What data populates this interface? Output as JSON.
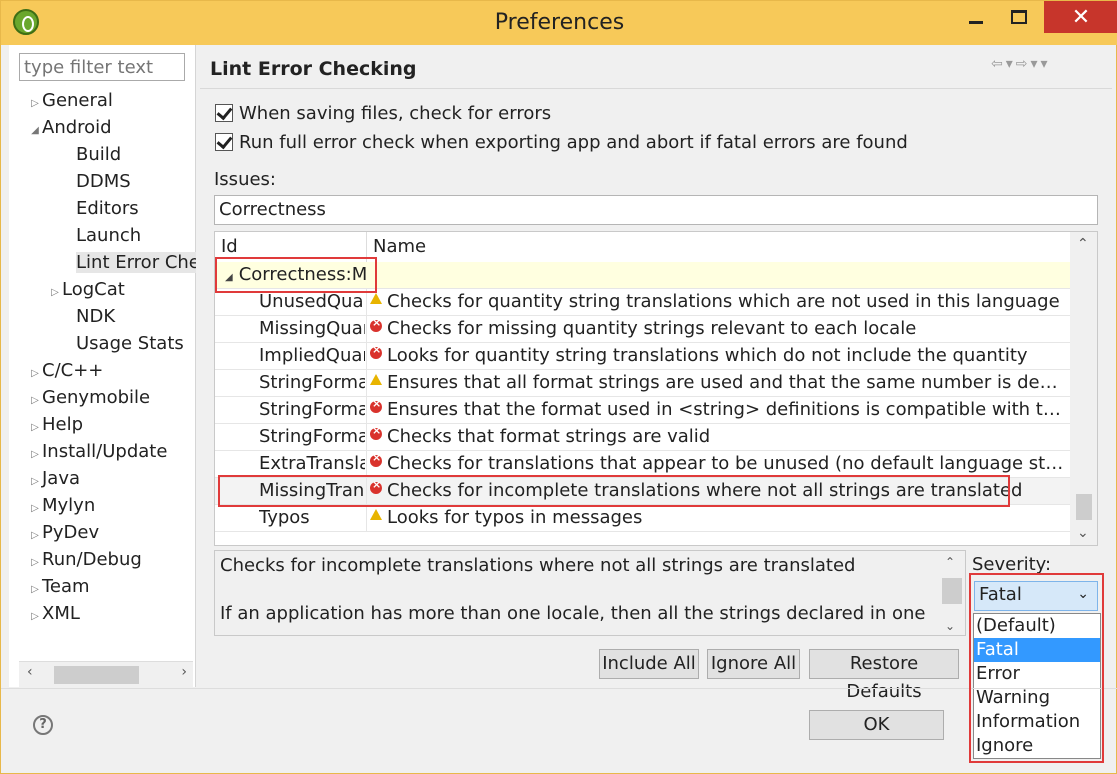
{
  "window": {
    "title": "Preferences",
    "close_glyph": "✕"
  },
  "filter": {
    "placeholder": "type filter text"
  },
  "tree": [
    {
      "label": "General",
      "level": 0,
      "arrow": "▷"
    },
    {
      "label": "Android",
      "level": 0,
      "arrow": "◢"
    },
    {
      "label": "Build",
      "level": 1,
      "arrow": ""
    },
    {
      "label": "DDMS",
      "level": 1,
      "arrow": ""
    },
    {
      "label": "Editors",
      "level": 1,
      "arrow": ""
    },
    {
      "label": "Launch",
      "level": 1,
      "arrow": ""
    },
    {
      "label": "Lint Error Checking",
      "level": 1,
      "arrow": "",
      "selected": true
    },
    {
      "label": "LogCat",
      "level": 1,
      "arrow": "▷"
    },
    {
      "label": "NDK",
      "level": 1,
      "arrow": ""
    },
    {
      "label": "Usage Stats",
      "level": 1,
      "arrow": ""
    },
    {
      "label": "C/C++",
      "level": 0,
      "arrow": "▷"
    },
    {
      "label": "Genymobile",
      "level": 0,
      "arrow": "▷"
    },
    {
      "label": "Help",
      "level": 0,
      "arrow": "▷"
    },
    {
      "label": "Install/Update",
      "level": 0,
      "arrow": "▷"
    },
    {
      "label": "Java",
      "level": 0,
      "arrow": "▷"
    },
    {
      "label": "Mylyn",
      "level": 0,
      "arrow": "▷"
    },
    {
      "label": "PyDev",
      "level": 0,
      "arrow": "▷"
    },
    {
      "label": "Run/Debug",
      "level": 0,
      "arrow": "▷"
    },
    {
      "label": "Team",
      "level": 0,
      "arrow": "▷"
    },
    {
      "label": "XML",
      "level": 0,
      "arrow": "▷"
    }
  ],
  "page": {
    "title": "Lint Error Checking",
    "check_save": "When saving files, check for errors",
    "check_export": "Run full error check when exporting app and abort if fatal errors are found",
    "issues_label": "Issues:",
    "issues_value": "Correctness"
  },
  "table": {
    "col_id": "Id",
    "col_name": "Name",
    "group": "Correctness:Messages",
    "rows": [
      {
        "id": "UnusedQuantity",
        "severity": "warning",
        "name": "Checks for quantity string translations which are not used in this language"
      },
      {
        "id": "MissingQuantity",
        "severity": "error",
        "name": "Checks for missing quantity strings relevant to each locale"
      },
      {
        "id": "ImpliedQuantity",
        "severity": "error",
        "name": "Looks for quantity string translations which do not include the quantity"
      },
      {
        "id": "StringFormatCount",
        "severity": "warning",
        "name": "Ensures that all format strings are used and that the same number is defined …"
      },
      {
        "id": "StringFormatMatches",
        "severity": "error",
        "name": "Ensures that the format used in <string> definitions is compatible with the St…"
      },
      {
        "id": "StringFormatInvalid",
        "severity": "error",
        "name": "Checks that format strings are valid"
      },
      {
        "id": "ExtraTranslation",
        "severity": "error",
        "name": "Checks for translations that appear to be unused (no default language string)"
      },
      {
        "id": "MissingTranslation",
        "severity": "error",
        "name": "Checks for incomplete translations where not all strings are translated",
        "highlighted": true
      },
      {
        "id": "Typos",
        "severity": "warning",
        "name": "Looks for typos in messages"
      }
    ]
  },
  "description": {
    "line1": "Checks for incomplete translations where not all strings are translated",
    "line2": "If an application has more than one locale, then all the strings declared in one"
  },
  "severity": {
    "label": "Severity:",
    "selected": "Fatal",
    "options": [
      "(Default)",
      "Fatal",
      "Error",
      "Warning",
      "Information",
      "Ignore"
    ]
  },
  "buttons": {
    "include_all": "Include All",
    "ignore_all": "Ignore All",
    "restore_defaults": "Restore Defaults",
    "ok": "OK"
  },
  "colors": {
    "titlebar": "#f7c959",
    "close": "#c7352b",
    "highlight_box": "#e03a3a",
    "selection": "#3399ff"
  }
}
